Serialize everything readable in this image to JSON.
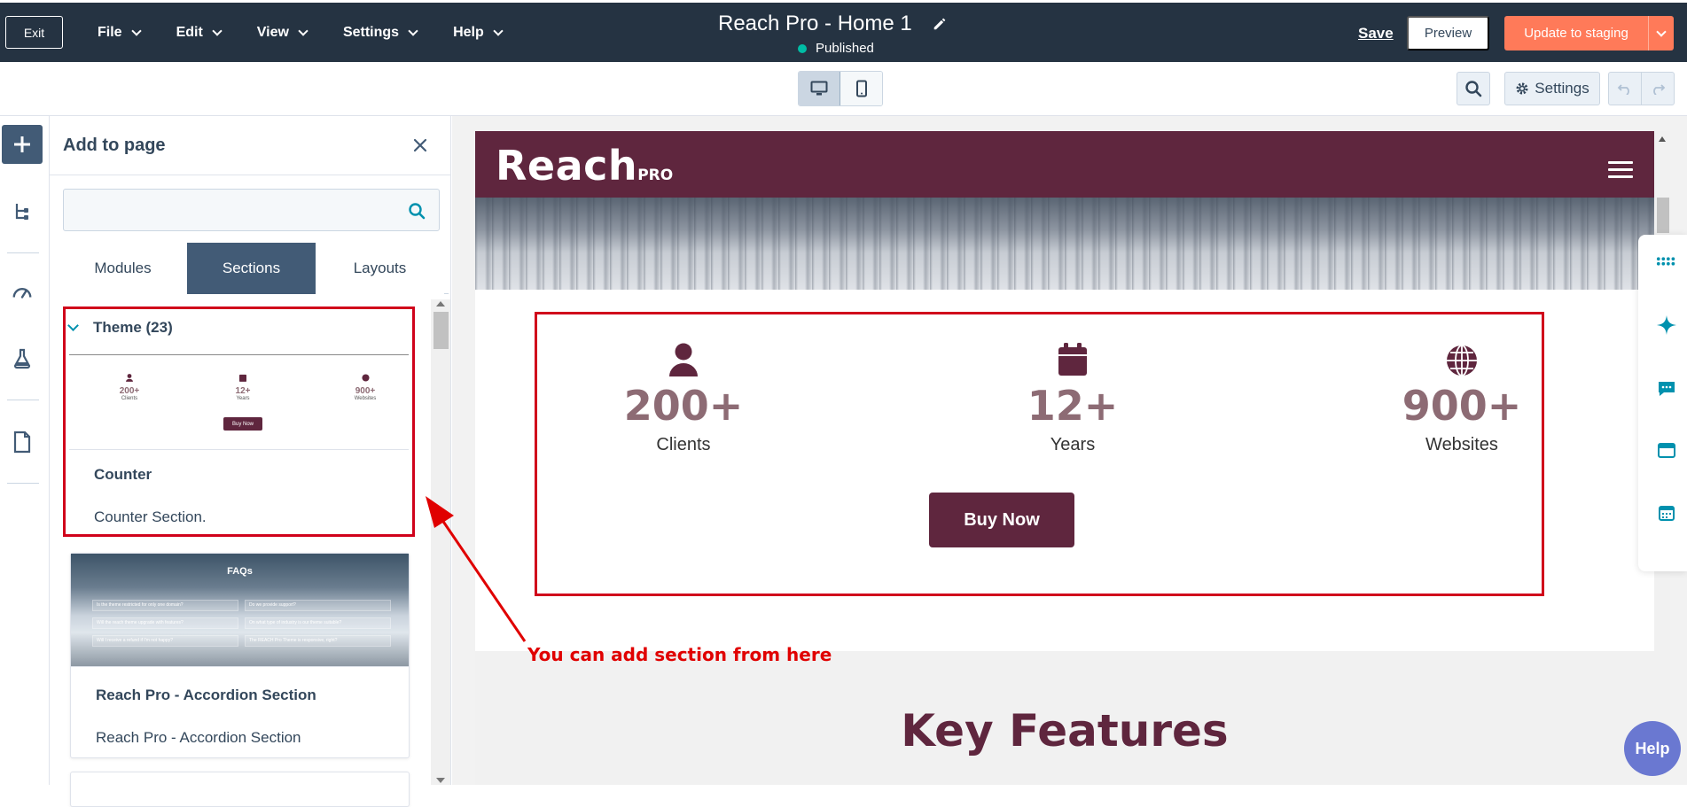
{
  "topbar": {
    "exit_label": "Exit",
    "menus": [
      "File",
      "Edit",
      "View",
      "Settings",
      "Help"
    ],
    "page_title": "Reach Pro - Home 1",
    "status": "Published",
    "save_label": "Save",
    "preview_label": "Preview",
    "update_label": "Update to staging"
  },
  "toolbar": {
    "settings_label": "Settings"
  },
  "panel": {
    "title": "Add to page",
    "search_placeholder": "",
    "tabs": [
      "Modules",
      "Sections",
      "Layouts"
    ],
    "active_tab": "Sections",
    "group_label": "Theme (23)",
    "cards": [
      {
        "name": "Counter",
        "description": "Counter Section.",
        "thumb": {
          "counters": [
            {
              "value": "200+",
              "label": "Clients"
            },
            {
              "value": "12+",
              "label": "Years"
            },
            {
              "value": "900+",
              "label": "Websites"
            }
          ],
          "button": "Buy Now"
        }
      },
      {
        "name": "Reach Pro - Accordion Section",
        "description": "Reach Pro - Accordion Section",
        "thumb": {
          "title": "FAQs",
          "rows": [
            "Is the theme restricted for only one domain?",
            "Do we provide support?",
            "Will the reach theme upgrade with features?",
            "On what type of industry is our theme suitable?",
            "Will I receive a refund if I'm not happy?",
            "The REACH Pro Theme is responsive, right?"
          ]
        }
      }
    ]
  },
  "preview": {
    "logo_text": "Reach",
    "logo_suffix": "PRO",
    "counters": [
      {
        "icon": "user-icon",
        "value": "200+",
        "label": "Clients"
      },
      {
        "icon": "calendar-icon",
        "value": "12+",
        "label": "Years"
      },
      {
        "icon": "globe-icon",
        "value": "900+",
        "label": "Websites"
      }
    ],
    "button_label": "Buy Now",
    "next_heading": "Key Features"
  },
  "annotation": {
    "text": "You can add section from here"
  },
  "help_label": "Help",
  "colors": {
    "topbar": "#253342",
    "accent_orange": "#ff7a59",
    "brand": "#5f263e",
    "counter_number": "#8d6b74",
    "annotation_red": "#d0021b",
    "status_dot": "#00bda5",
    "active_tab": "#425b76"
  }
}
